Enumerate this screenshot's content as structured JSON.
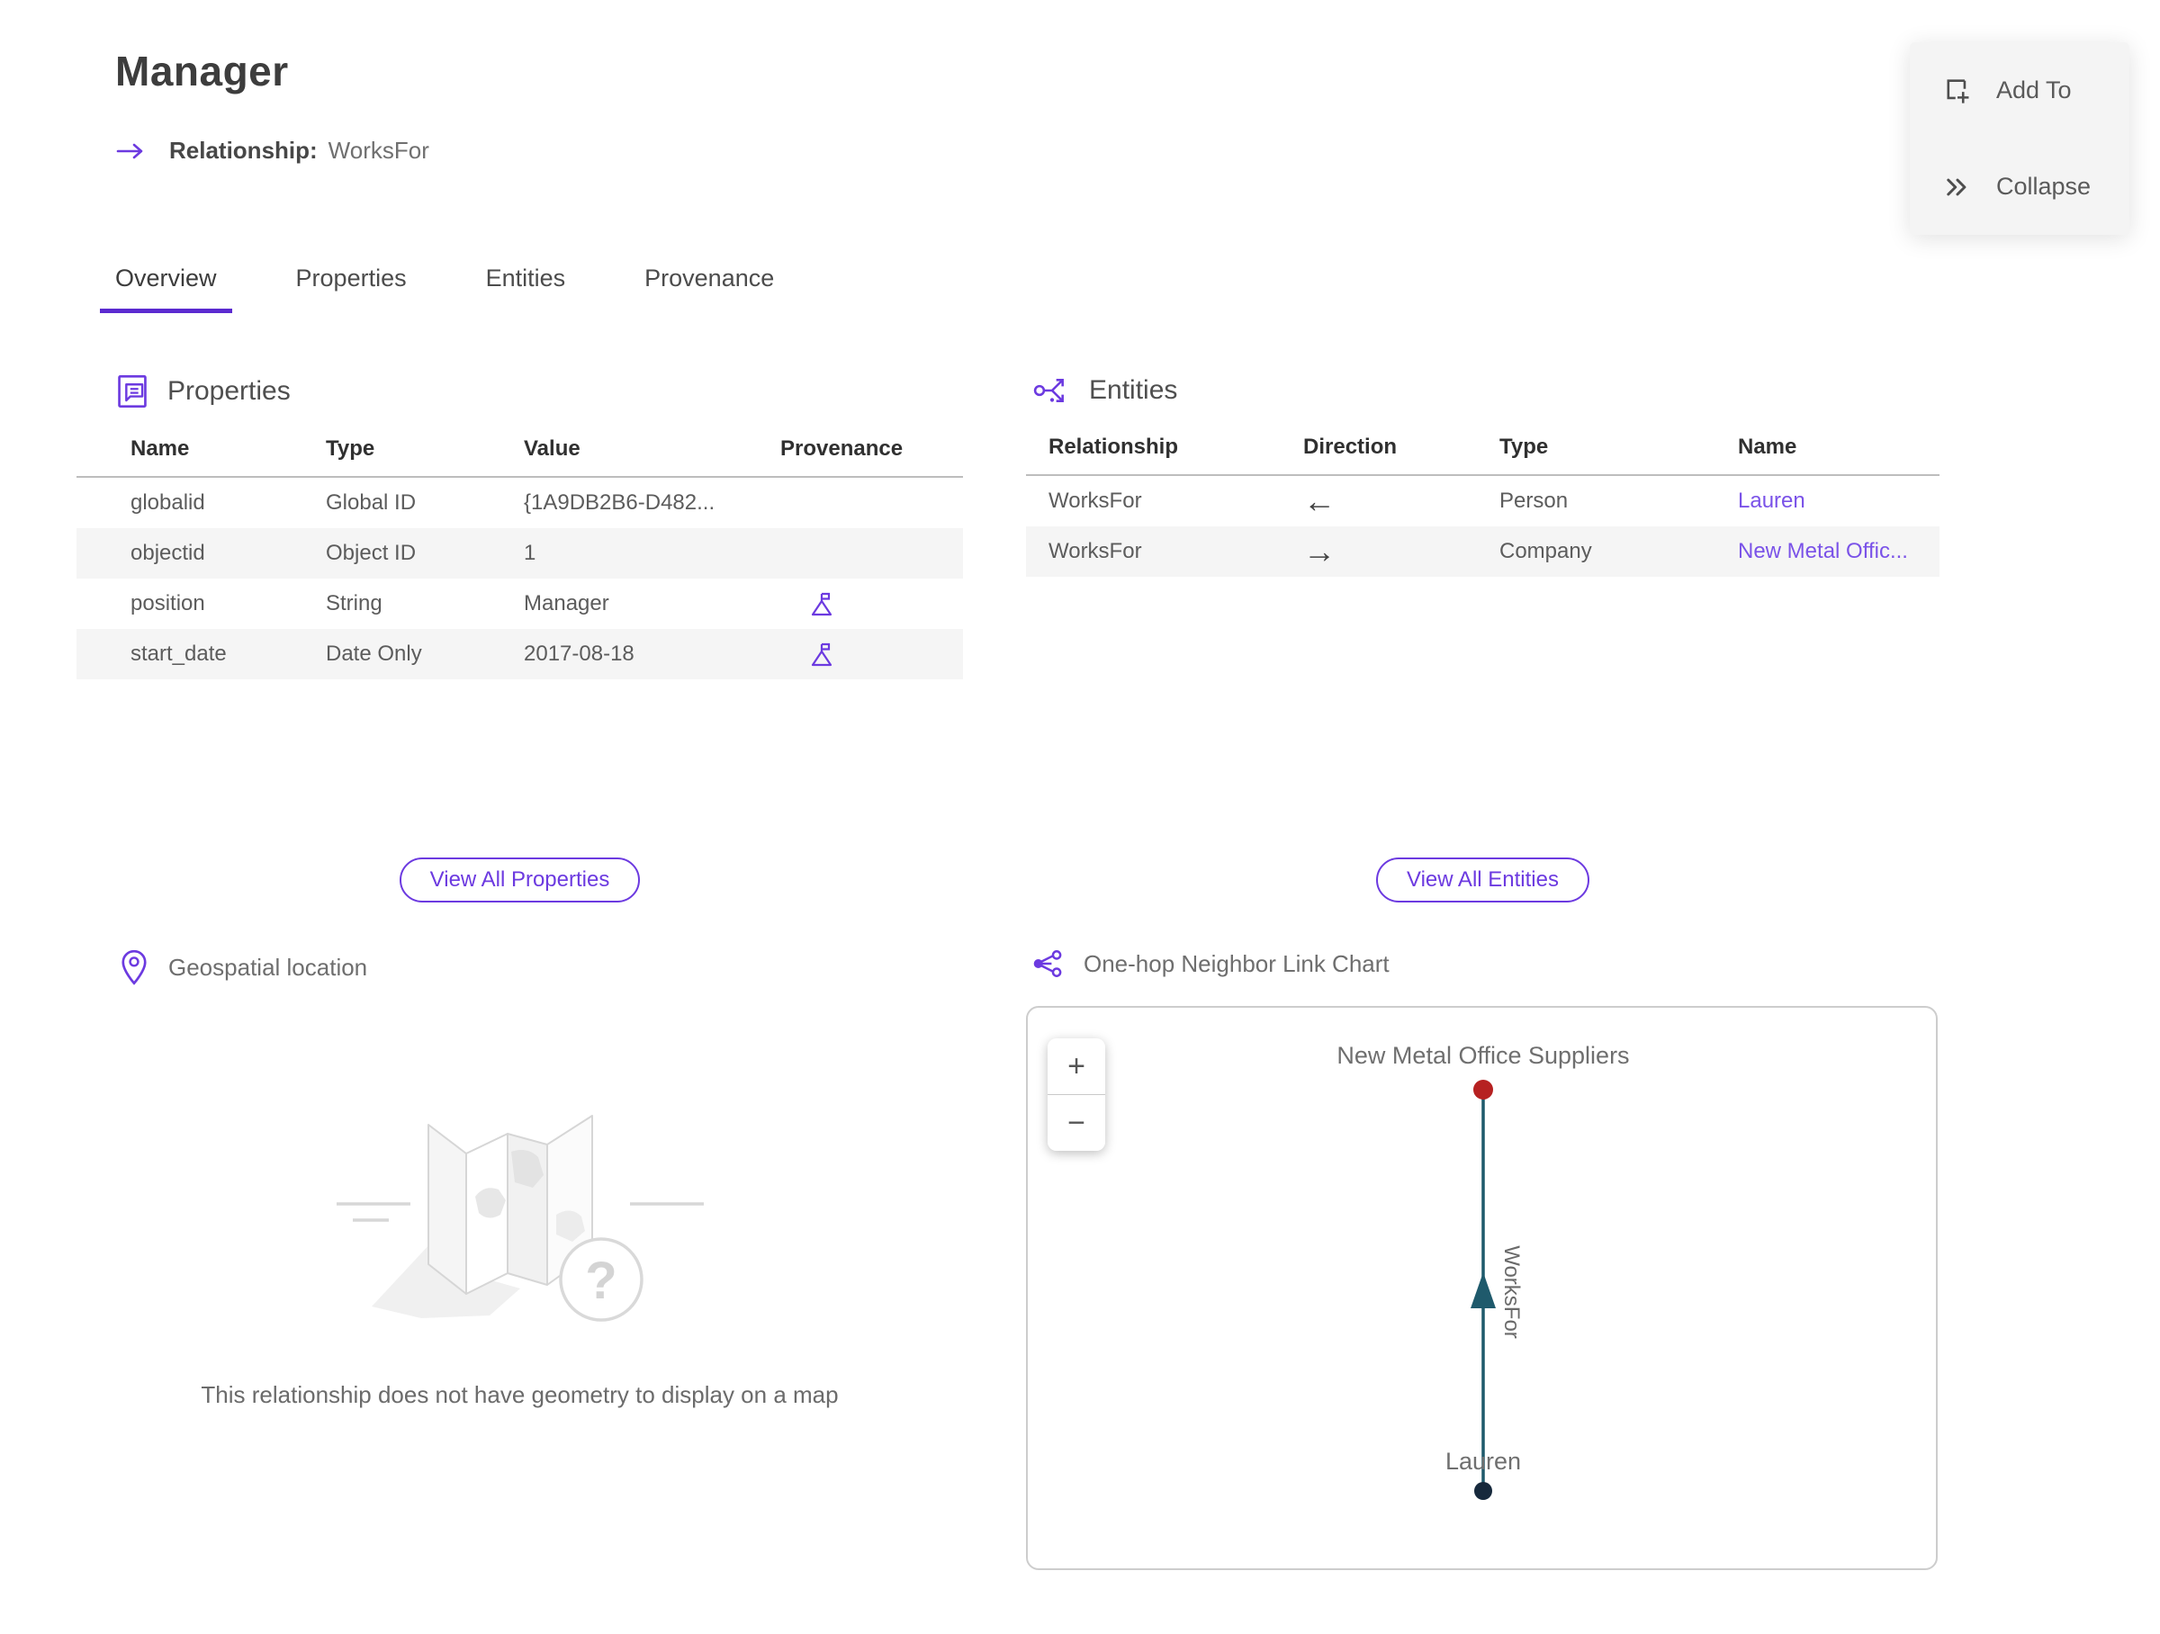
{
  "header": {
    "title": "Manager",
    "relationship_label": "Relationship:",
    "relationship_value": "WorksFor"
  },
  "actions": {
    "add_to": "Add To",
    "collapse": "Collapse"
  },
  "tabs": [
    {
      "label": "Overview",
      "active": true
    },
    {
      "label": "Properties",
      "active": false
    },
    {
      "label": "Entities",
      "active": false
    },
    {
      "label": "Provenance",
      "active": false
    }
  ],
  "properties": {
    "heading": "Properties",
    "columns": [
      "Name",
      "Type",
      "Value",
      "Provenance"
    ],
    "rows": [
      {
        "name": "globalid",
        "type": "Global ID",
        "value": "{1A9DB2B6-D482...",
        "provenance": false
      },
      {
        "name": "objectid",
        "type": "Object ID",
        "value": "1",
        "provenance": false
      },
      {
        "name": "position",
        "type": "String",
        "value": "Manager",
        "provenance": true
      },
      {
        "name": "start_date",
        "type": "Date Only",
        "value": "2017-08-18",
        "provenance": true
      }
    ],
    "view_all": "View All Properties"
  },
  "entities": {
    "heading": "Entities",
    "columns": [
      "Relationship",
      "Direction",
      "Type",
      "Name"
    ],
    "rows": [
      {
        "relationship": "WorksFor",
        "direction": "←",
        "type": "Person",
        "name": "Lauren"
      },
      {
        "relationship": "WorksFor",
        "direction": "→",
        "type": "Company",
        "name": "New Metal Offic..."
      }
    ],
    "view_all": "View All Entities"
  },
  "geospatial": {
    "heading": "Geospatial location",
    "empty_message": "This relationship does not have geometry to display on a map"
  },
  "link_chart": {
    "heading": "One-hop Neighbor Link Chart",
    "zoom_in_label": "+",
    "zoom_out_label": "−",
    "top_node_label": "New Metal Office Suppliers",
    "edge_label": "WorksFor",
    "bottom_node_label": "Lauren",
    "top_node_color": "#b62121",
    "bottom_node_color": "#16293c",
    "edge_color": "#1f5a6c"
  },
  "colors": {
    "accent": "#6c3ae0",
    "link": "#7a52e8",
    "tab_underline": "#5b2ad0"
  }
}
